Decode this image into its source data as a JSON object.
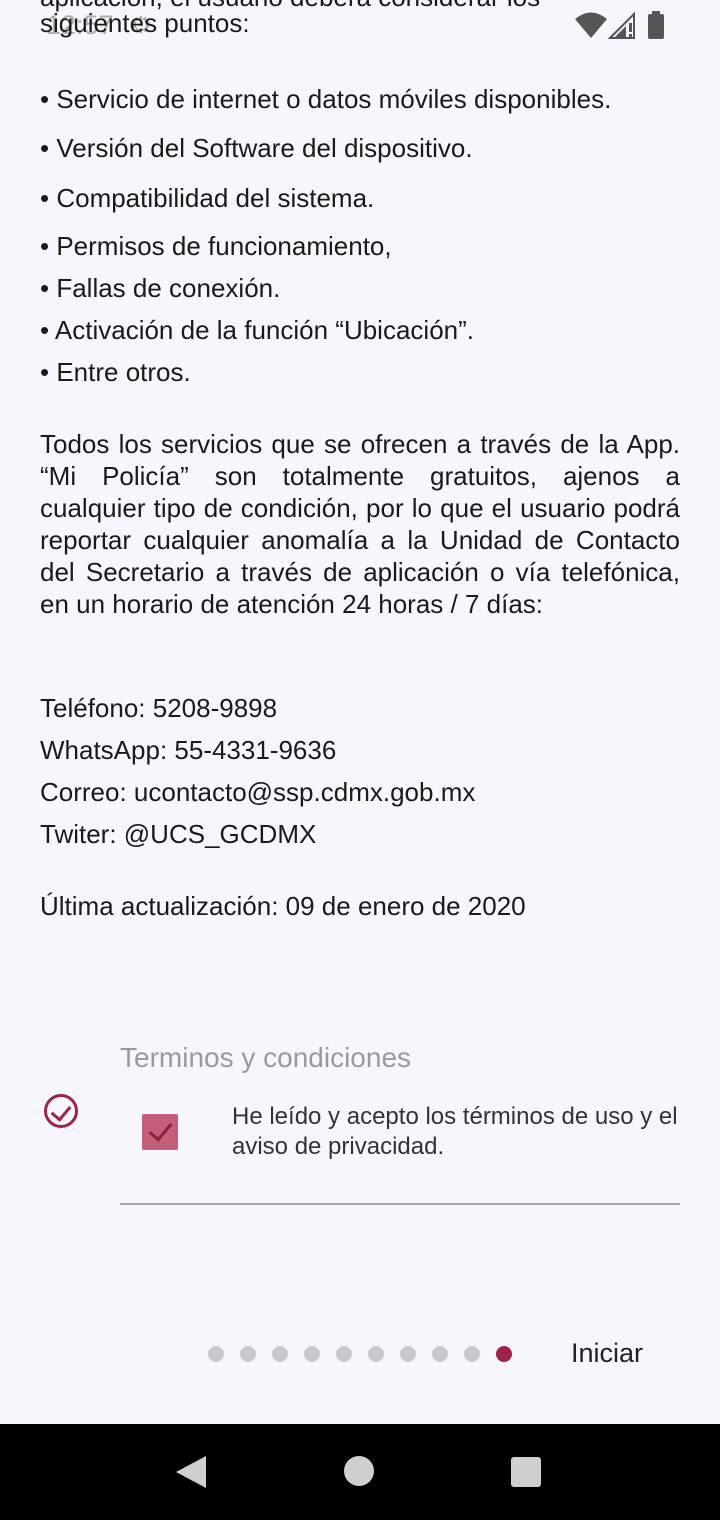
{
  "status_bar": {
    "time": "12:57",
    "gear_icon": "gear-icon"
  },
  "top_text": {
    "cut_line": "aplicación, el usuario deberá considerar los",
    "cont_line": "siguientes puntos:"
  },
  "bullets": [
    "• Servicio de internet o datos móviles disponibles.",
    "• Versión del Software del dispositivo.",
    "• Compatibilidad del sistema.",
    "• Permisos de funcionamiento,",
    "• Fallas de conexión.",
    "• Activación de la función “Ubicación”.",
    "• Entre otros."
  ],
  "paragraph": "Todos los servicios que se ofrecen a través de la App. “Mi Policía” son totalmente gratuitos, ajenos a cualquier tipo de condición, por lo que el usuario podrá reportar cualquier anomalía a la Unidad de Contacto del Secretario a través de aplicación o vía telefónica, en un horario de atención 24 horas / 7 días:",
  "contact": {
    "phone": "Teléfono: 5208-9898",
    "whatsapp": "WhatsApp: 55-4331-9636",
    "email": "Correo: ucontacto@ssp.cdmx.gob.mx",
    "twitter": "Twiter: @UCS_GCDMX"
  },
  "last_update": "Última actualización: 09 de enero de 2020",
  "terms": {
    "title": "Terminos y condiciones",
    "accept_label": "He leído y acepto los términos de uso y el aviso de privacidad.",
    "checked": true
  },
  "pager": {
    "total": 10,
    "current": 10,
    "start_label": "Iniciar"
  }
}
